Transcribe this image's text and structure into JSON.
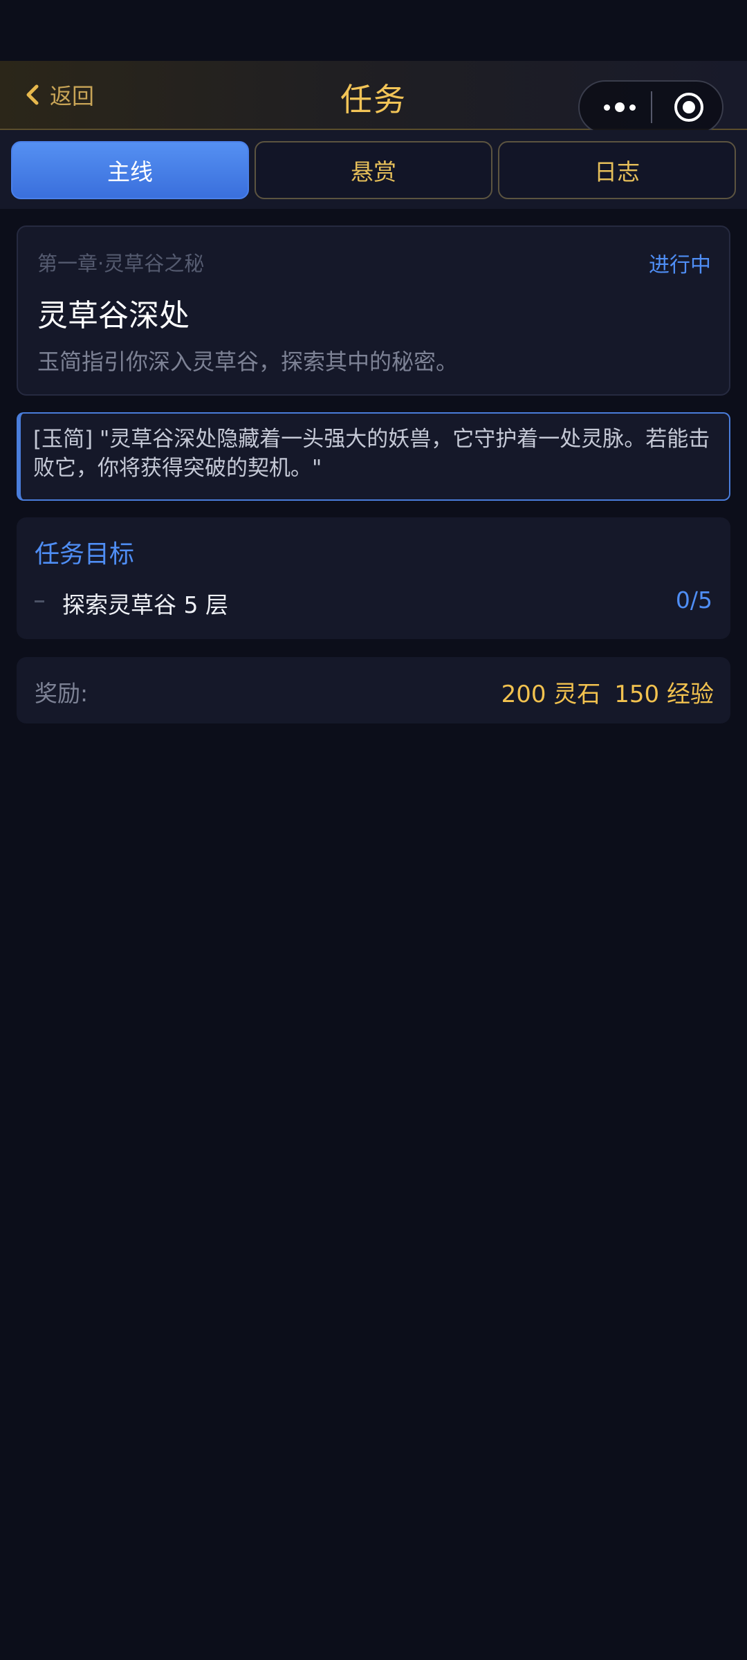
{
  "header": {
    "back_label": "返回",
    "title": "任务",
    "capsule_more_icon": "more-dots-icon",
    "capsule_close_icon": "target-circle-icon"
  },
  "tabs": [
    {
      "label": "主线",
      "active": true
    },
    {
      "label": "悬赏",
      "active": false
    },
    {
      "label": "日志",
      "active": false
    }
  ],
  "quest": {
    "chapter": "第一章·灵草谷之秘",
    "status": "进行中",
    "title": "灵草谷深处",
    "description": "玉简指引你深入灵草谷，探索其中的秘密。"
  },
  "dialogue": {
    "text": "[玉简] \"灵草谷深处隐藏着一头强大的妖兽，它守护着一处灵脉。若能击败它，你将获得突破的契机。\""
  },
  "objectives": {
    "title": "任务目标",
    "items": [
      {
        "text": "探索灵草谷 5 层",
        "progress": "0/5",
        "current": 0,
        "total": 5
      }
    ]
  },
  "rewards": {
    "label": "奖励:",
    "items": [
      "200 灵石",
      "150 经验"
    ]
  },
  "colors": {
    "background": "#0c0e1a",
    "card": "#151829",
    "gold": "#f2c457",
    "blue_accent": "#4f8ef5",
    "active_tab": "#4a80ea"
  }
}
